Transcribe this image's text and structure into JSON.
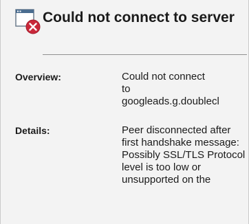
{
  "dialog": {
    "title": "Could not connect to server",
    "icon": "window-error-icon",
    "colors": {
      "background": "#f3f3f3",
      "error_red": "#c9283a",
      "window_blue": "#4a6c8f"
    }
  },
  "details": {
    "overview_label": "Overview:",
    "overview_value_line1": "Could not connect",
    "overview_value_line2": "to",
    "overview_value_line3": "googleads.g.doublecl",
    "details_label": "Details:",
    "details_value": "Peer disconnected after first handshake message: Possibly SSL/TLS Protocol level is too low or unsupported on the"
  }
}
